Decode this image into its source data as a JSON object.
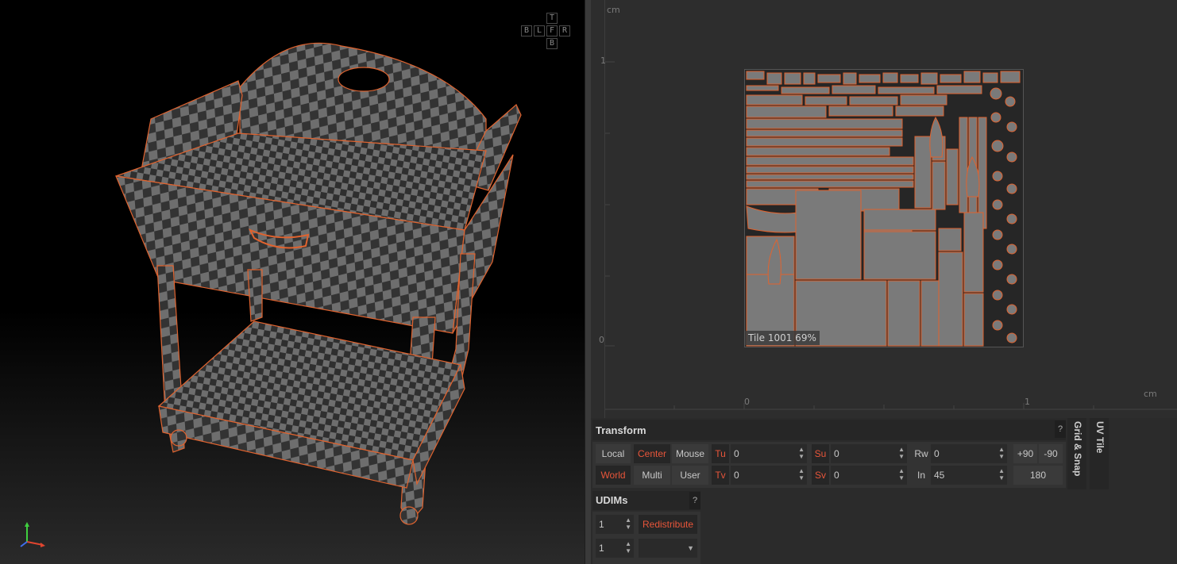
{
  "navcube": {
    "top": "T",
    "left_b": "B",
    "left": "L",
    "front": "F",
    "right": "R",
    "bottom": "B"
  },
  "uv": {
    "unit_top": "cm",
    "unit_right": "cm",
    "tick_v1": "1",
    "tick_v0": "0",
    "tick_u0": "0",
    "tick_u1": "1",
    "tile_label": "Tile 1001 69%"
  },
  "transform": {
    "title": "Transform",
    "help": "?",
    "local": "Local",
    "world": "World",
    "center": "Center",
    "multi": "Multi",
    "mouse": "Mouse",
    "user": "User",
    "tu_label": "Tu",
    "tu_value": "0",
    "tv_label": "Tv",
    "tv_value": "0",
    "su_label": "Su",
    "su_value": "0",
    "sv_label": "Sv",
    "sv_value": "0",
    "rw_label": "Rw",
    "rw_value": "0",
    "in_label": "In",
    "in_value": "45",
    "plus90": "+90",
    "minus90": "-90",
    "r180": "180"
  },
  "side_tabs": {
    "grid_snap": "Grid & Snap",
    "uv_tile": "UV Tile"
  },
  "udims": {
    "title": "UDIMs",
    "help": "?",
    "u_value": "1",
    "v_value": "1",
    "redistribute": "Redistribute",
    "dropdown_value": ""
  },
  "colors": {
    "accent": "#e8553a",
    "panel": "#2b2b2b",
    "uv_bg": "#2d2d2d"
  }
}
